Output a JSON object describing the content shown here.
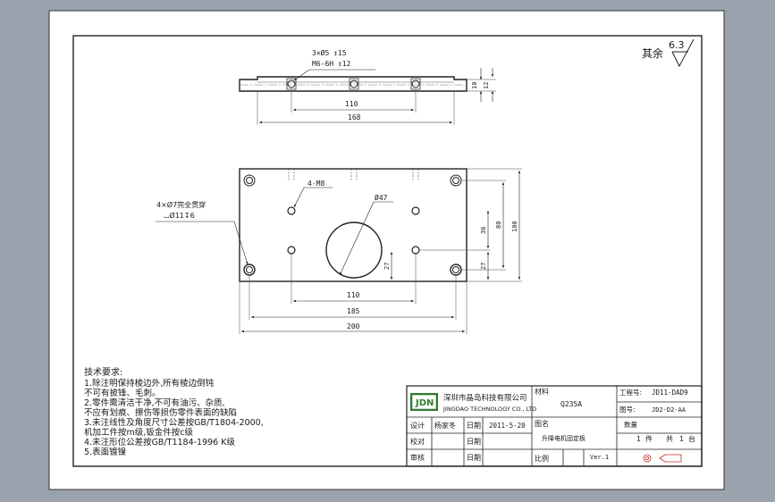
{
  "surface_roughness": {
    "label": "其余",
    "value": "6.3"
  },
  "top_view": {
    "callout_line1": "3×Ø5 ↧15",
    "callout_line2": "M6-6H ↧12",
    "dims": {
      "hole_spacing": "110",
      "overall_length": "168",
      "thickness_a": "10",
      "thickness_b": "12"
    }
  },
  "front_view": {
    "thread_callout": "4-M8",
    "counterbore_line1": "4×Ø7完全贯穿",
    "counterbore_line2": "⌴Ø11↧6",
    "bore_dia": "Ø47",
    "dims": {
      "inner_spacing": "110",
      "hole_spacing": "185",
      "overall_length": "200",
      "half_height_a": "36",
      "height_80": "80",
      "height_100": "100",
      "lower_a": "27",
      "lower_b": "27"
    }
  },
  "tech_requirements": {
    "title": "技术要求:",
    "lines": [
      "1.除注明保持棱边外,所有棱边倒钝",
      "  不可有披锋、毛刺。",
      "2.零件需清洁干净,不可有油污、杂质,",
      "  不应有划痕、擦伤等损伤零件表面的缺陷",
      "3.未注线性及角度尺寸公差按GB/T1804-2000,",
      "  机加工件按m级,钣金件按c级",
      "4.未注形位公差按GB/T1184-1996 K级",
      "5.表面镀镍"
    ]
  },
  "title_block": {
    "logo": "JDN",
    "company_cn": "深圳市晶岛科技有限公司",
    "company_en": "JINGDAO TECHNOLOGY CO., LTD",
    "material_label": "材料",
    "material": "Q235A",
    "project_no_label": "工程号:",
    "project_no": "JD11-DAD9",
    "drawing_no_label": "图号:",
    "drawing_no": "JD2-D2-AA",
    "designer_label": "设计",
    "designer": "杨家冬",
    "date_label": "日期",
    "date": "2011-5-20",
    "drawing_name_label": "图名",
    "drawing_name": "升降电机固定板",
    "quantity_label": "数量",
    "quantity_value": "1",
    "quantity_unit": "件",
    "total_label": "共",
    "total_value": "1",
    "total_unit": "台",
    "check_label": "校对",
    "check_date_label": "日期",
    "approve_label": "审核",
    "approve_date_label": "日期",
    "scale_label": "比例",
    "version": "Ver.1"
  }
}
